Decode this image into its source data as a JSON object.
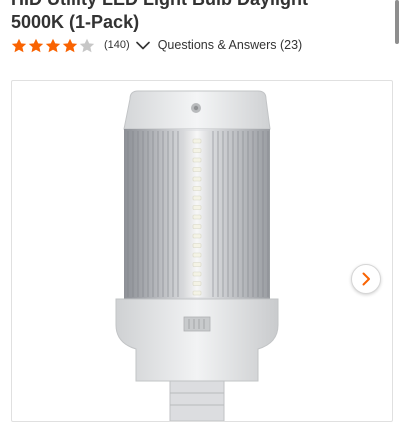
{
  "product": {
    "title_line1": "HID Utility LED Light Bulb Daylight",
    "title_line2": "5000K (1-Pack)",
    "rating": 4,
    "rating_max": 5,
    "review_count": "(140)",
    "qa_link": "Questions & Answers (23)"
  },
  "colors": {
    "star_filled": "#f96302",
    "star_empty": "#c7c7c7",
    "chevron": "#f96302"
  },
  "icons": {
    "rating_star": "star-icon",
    "expand_chevron": "chevron-down-icon",
    "carousel_next": "chevron-right-icon"
  }
}
